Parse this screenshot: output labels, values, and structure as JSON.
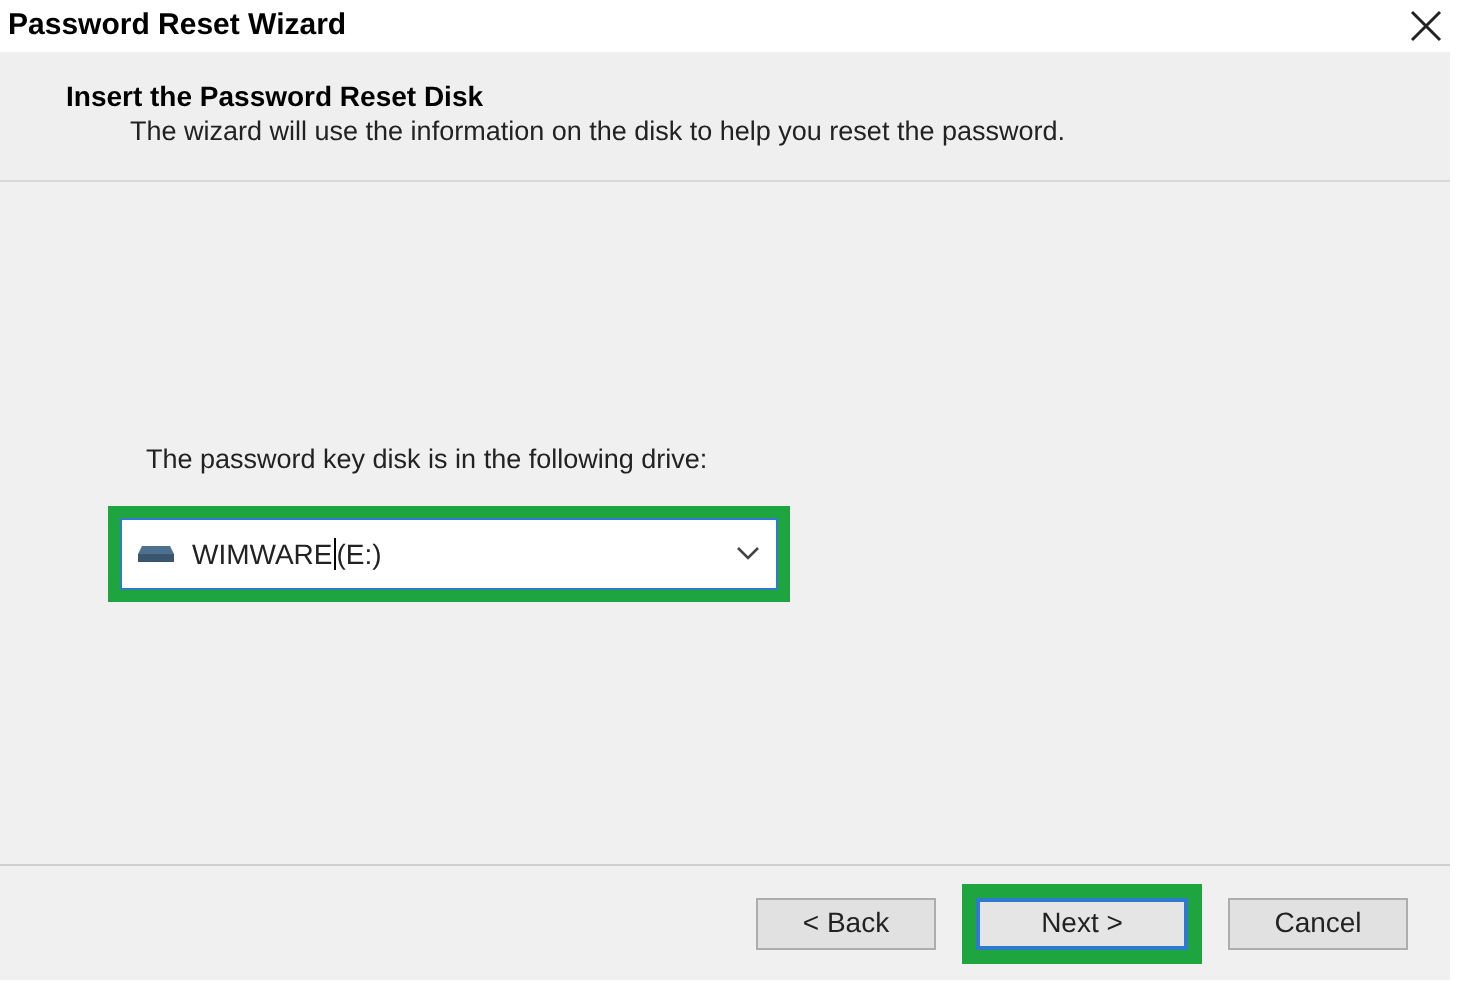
{
  "window": {
    "title": "Password Reset Wizard"
  },
  "header": {
    "title": "Insert the Password Reset Disk",
    "subtitle": "The wizard will use the information on the disk to help you reset the password."
  },
  "drive": {
    "label": "The password key disk is in the following drive:",
    "value": "WIMWARE",
    "value_suffix": "(E:)",
    "highlighted": true
  },
  "buttons": [
    {
      "label": "< Back",
      "focused": false,
      "highlighted": false
    },
    {
      "label": "Next >",
      "focused": true,
      "highlighted": true
    },
    {
      "label": "Cancel",
      "focused": false,
      "highlighted": false
    }
  ]
}
